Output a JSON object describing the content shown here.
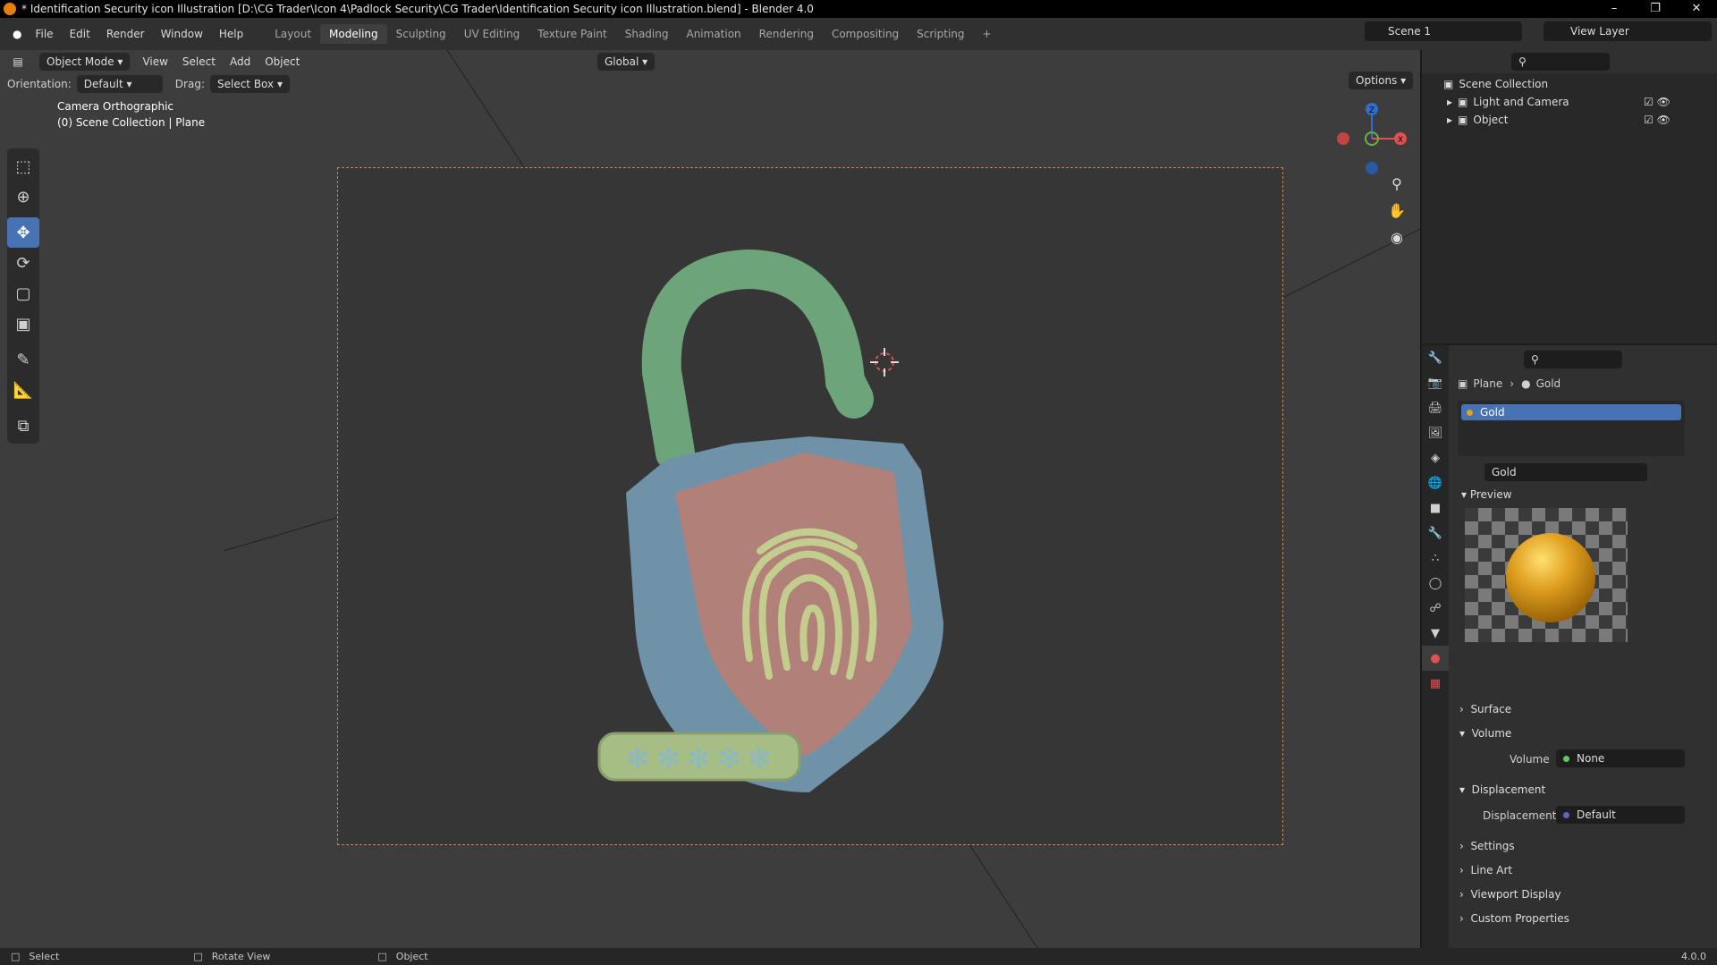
{
  "window": {
    "title": "* Identification Security icon Illustration [D:\\CG Trader\\Icon 4\\Padlock Security\\CG Trader\\Identification Security icon Illustration.blend] - Blender 4.0",
    "minimize": "–",
    "maximize": "❐",
    "close": "✕"
  },
  "menu": [
    "File",
    "Edit",
    "Render",
    "Window",
    "Help"
  ],
  "workspaces": [
    "Layout",
    "Modeling",
    "Sculpting",
    "UV Editing",
    "Texture Paint",
    "Shading",
    "Animation",
    "Rendering",
    "Compositing",
    "Scripting"
  ],
  "add_workspace": "+",
  "scene": {
    "name": "Scene 1",
    "view_layer": "View Layer"
  },
  "viewport": {
    "mode": "Object Mode",
    "menus": [
      "View",
      "Select",
      "Add",
      "Object"
    ],
    "transform_orientation": "Global",
    "options": "Options",
    "orientation_label": "Orientation:",
    "orientation_value": "Default",
    "drag_label": "Drag:",
    "drag_value": "Select Box",
    "camera_line1": "Camera Orthographic",
    "camera_line2": "(0) Scene Collection | Plane",
    "gizmo": {
      "z": "Z",
      "x": "X"
    }
  },
  "outliner": {
    "root": "Scene Collection",
    "items": [
      "Light and Camera",
      "Object"
    ]
  },
  "properties": {
    "breadcrumb": {
      "object": "Plane",
      "material": "Gold"
    },
    "slot": "Gold",
    "material_name": "Gold",
    "panels": {
      "preview": "Preview",
      "surface": "Surface",
      "volume": "Volume",
      "volume_label": "Volume",
      "volume_value": "None",
      "displacement": "Displacement",
      "displacement_label": "Displacement",
      "displacement_value": "Default",
      "settings": "Settings",
      "line_art": "Line Art",
      "viewport_display": "Viewport Display",
      "custom_properties": "Custom Properties"
    }
  },
  "status": {
    "select": "Select",
    "rotate": "Rotate View",
    "object": "Object",
    "version": "4.0.0"
  },
  "colors": {
    "accent": "#4772b3",
    "selection": "#2f6fce",
    "frame": "#c7816a",
    "shackle": "#6ea47a",
    "shield_outer": "#6f92a8",
    "shield_inner": "#b08079",
    "fingerprint": "#b9c58a",
    "pin_bar": "#a6bd86",
    "pin_star": "#8bb8c2",
    "gold": "#e0a020"
  }
}
